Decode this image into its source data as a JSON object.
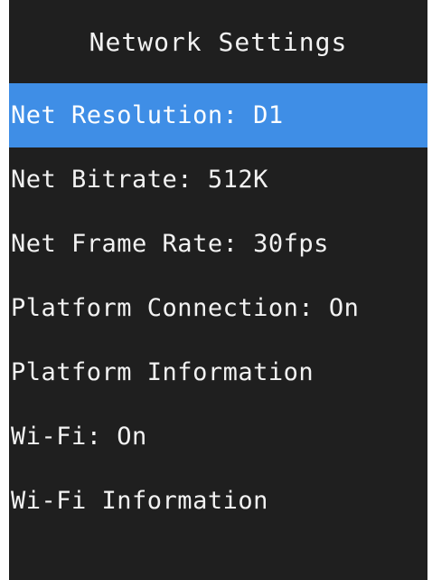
{
  "screen": {
    "title": "Network Settings",
    "selected_index": 0,
    "accent_color": "#3f8ee6"
  },
  "menu": {
    "items": [
      {
        "label": "Net Resolution: D1"
      },
      {
        "label": "Net Bitrate: 512K"
      },
      {
        "label": "Net Frame Rate: 30fps"
      },
      {
        "label": "Platform Connection: On"
      },
      {
        "label": "Platform Information"
      },
      {
        "label": "Wi-Fi: On"
      },
      {
        "label": "Wi-Fi Information"
      }
    ]
  }
}
